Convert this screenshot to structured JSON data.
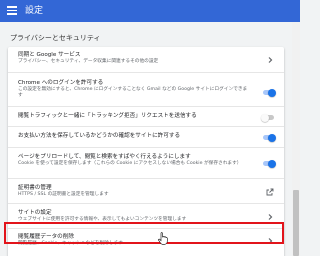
{
  "header": {
    "title": "設定"
  },
  "section": {
    "title": "プライバシーとセキュリティ"
  },
  "rows": [
    {
      "title": "同期と Google サービス",
      "desc": "プライバシー、セキュリティ、データ収集に関連するその他の設定"
    },
    {
      "title": "Chrome へのログインを許可する",
      "desc": "この設定を無効にすると、Chrome にログインすることなく Gmail などの Google サイトにログインできます",
      "toggle": "on"
    },
    {
      "title": "閲覧トラフィックと一緒に「トラッキング拒否」リクエストを送信する",
      "toggle": "off"
    },
    {
      "title": "お支払い方法を保存しているかどうかの確認をサイトに許可する",
      "toggle": "on"
    },
    {
      "title": "ページをプリロードして、閲覧と検索をすばやく行えるようにします",
      "desc": "Cookie を使って設定を保存します（これらの Cookie にアクセスしない場合も Cookie が保存されます）",
      "toggle": "on"
    },
    {
      "title": "証明書の管理",
      "desc": "HTTPS / SSL の証明書と設定を管理します"
    },
    {
      "title": "サイトの設定",
      "desc": "ウェブサイトに使用を許可する情報や、表示してもよいコンテンツを管理します"
    },
    {
      "title": "閲覧履歴データの削除",
      "desc": "閲覧履歴、Cookie、キャッシュなどを削除します"
    }
  ],
  "colors": {
    "accent": "#3367d6",
    "toggle_on": "#1a73e8",
    "highlight": "#e2141b"
  }
}
